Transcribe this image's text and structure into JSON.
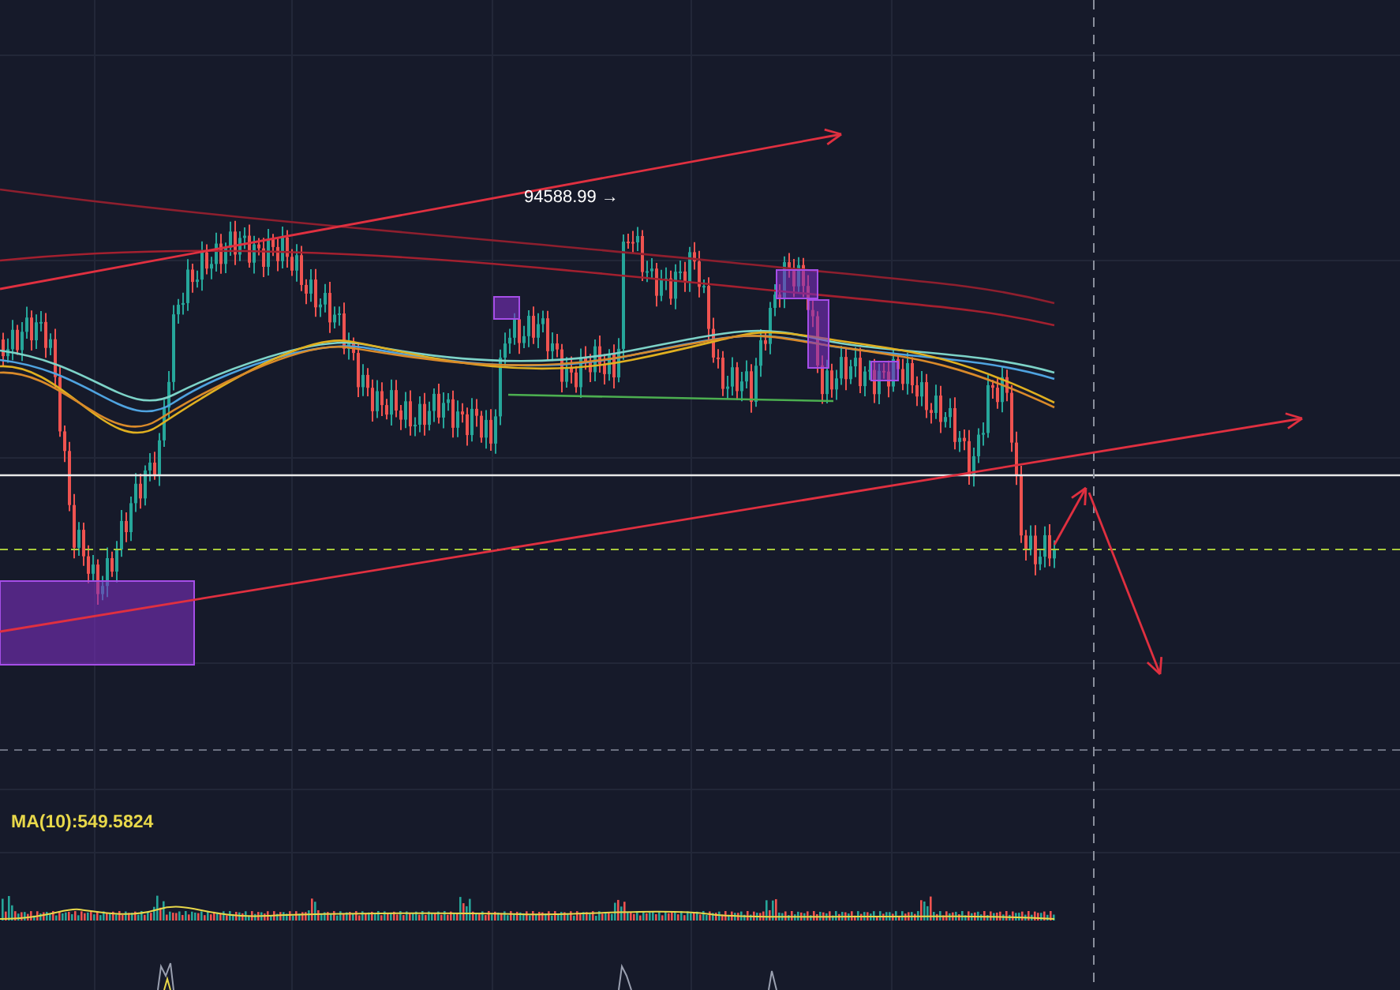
{
  "price_chart": {
    "price_marker": {
      "label": "94588.99 →"
    }
  },
  "volume_panel": {
    "indicator_label": "MA(10):549.5824"
  }
}
